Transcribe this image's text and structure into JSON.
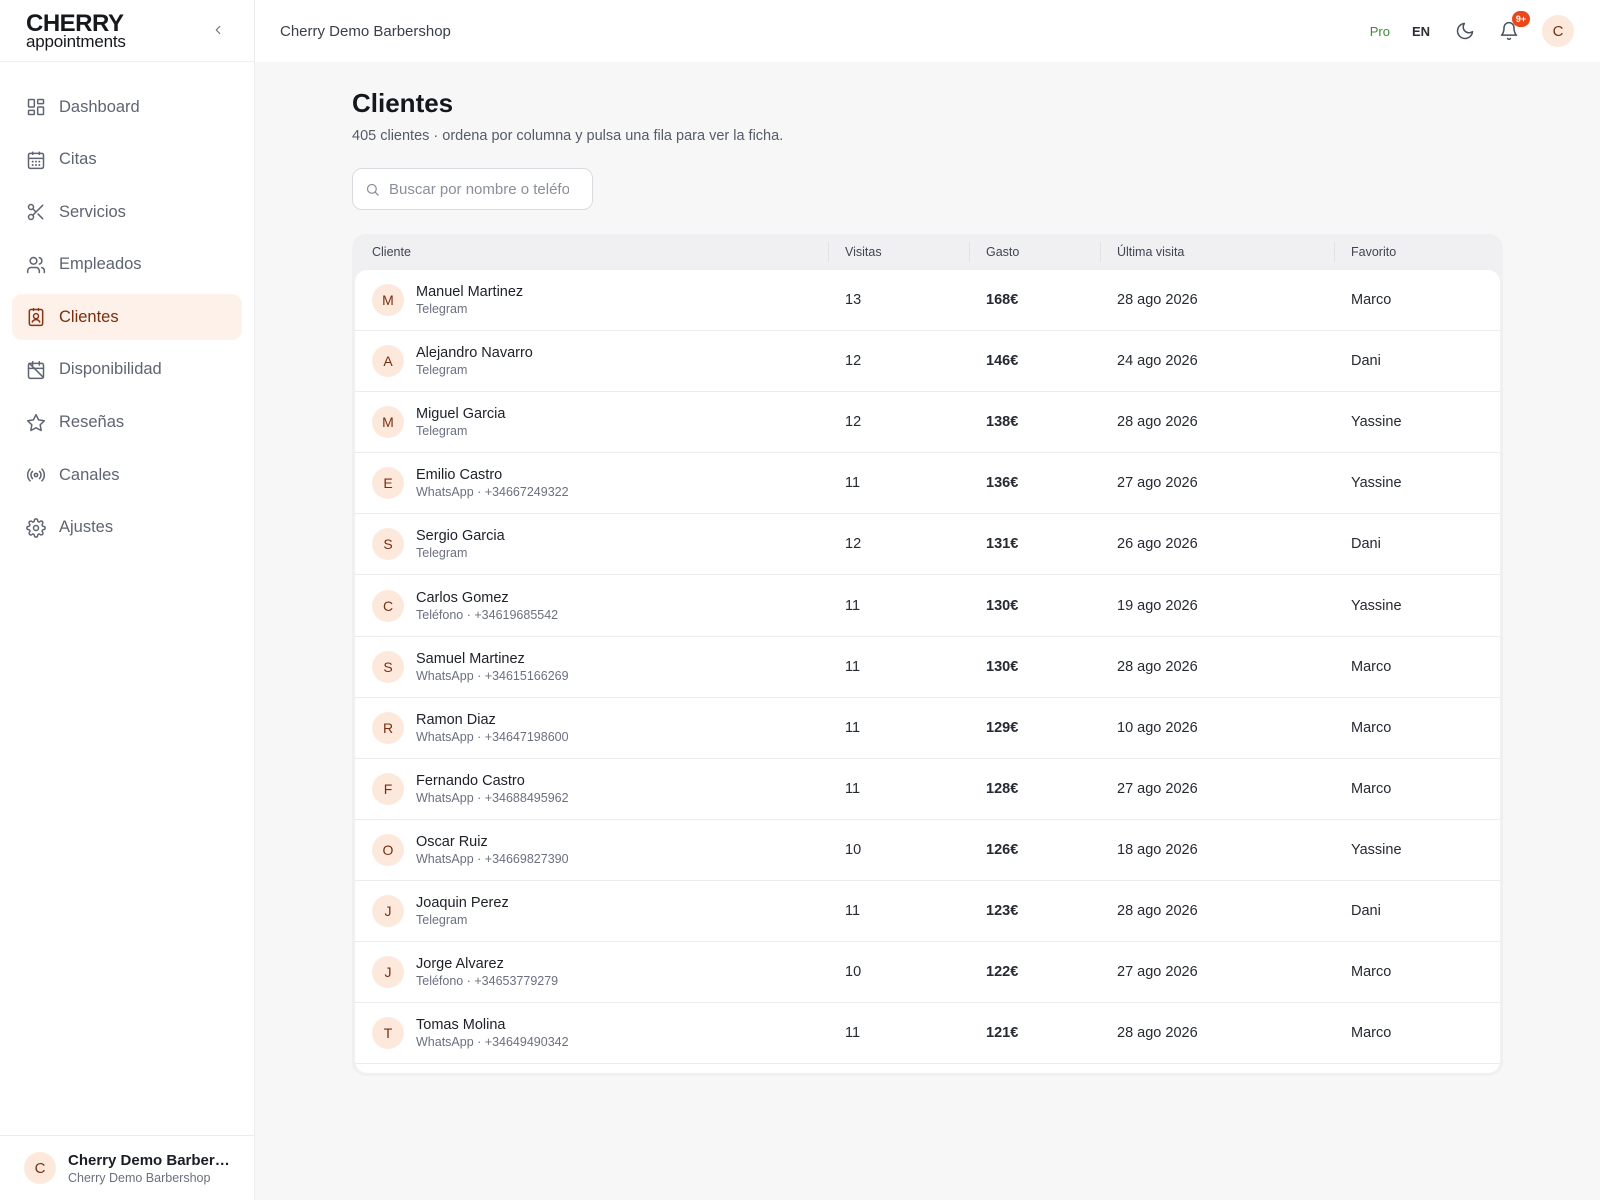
{
  "brand": {
    "main": "CHERRY",
    "sub": "appointments"
  },
  "sidebar": {
    "items": [
      {
        "label": "Dashboard",
        "icon": "dashboard-icon"
      },
      {
        "label": "Citas",
        "icon": "calendar-icon"
      },
      {
        "label": "Servicios",
        "icon": "scissors-icon"
      },
      {
        "label": "Empleados",
        "icon": "users-icon"
      },
      {
        "label": "Clientes",
        "icon": "contact-icon",
        "active": true
      },
      {
        "label": "Disponibilidad",
        "icon": "calendar-off-icon"
      },
      {
        "label": "Reseñas",
        "icon": "star-icon"
      },
      {
        "label": "Canales",
        "icon": "broadcast-icon"
      },
      {
        "label": "Ajustes",
        "icon": "gear-icon"
      }
    ],
    "footer": {
      "initial": "C",
      "name": "Cherry Demo Barbershop",
      "sub": "Cherry Demo Barbershop"
    }
  },
  "topbar": {
    "shop_name": "Cherry Demo Barbershop",
    "plan": "Pro",
    "language": "EN",
    "notifications_badge": "9+",
    "user_initial": "C"
  },
  "page": {
    "title": "Clientes",
    "subtitle": "405 clientes · ordena por columna y pulsa una fila para ver la ficha.",
    "search_placeholder": "Buscar por nombre o teléfono"
  },
  "table": {
    "columns": [
      "Cliente",
      "Visitas",
      "Gasto",
      "Última visita",
      "Favorito"
    ],
    "rows": [
      {
        "initial": "M",
        "name": "Manuel Martinez",
        "channel": "Telegram",
        "visits": "13",
        "spent": "168€",
        "last_visit": "28 ago 2026",
        "favorite": "Marco"
      },
      {
        "initial": "A",
        "name": "Alejandro Navarro",
        "channel": "Telegram",
        "visits": "12",
        "spent": "146€",
        "last_visit": "24 ago 2026",
        "favorite": "Dani"
      },
      {
        "initial": "M",
        "name": "Miguel Garcia",
        "channel": "Telegram",
        "visits": "12",
        "spent": "138€",
        "last_visit": "28 ago 2026",
        "favorite": "Yassine"
      },
      {
        "initial": "E",
        "name": "Emilio Castro",
        "channel": "WhatsApp · +34667249322",
        "visits": "11",
        "spent": "136€",
        "last_visit": "27 ago 2026",
        "favorite": "Yassine"
      },
      {
        "initial": "S",
        "name": "Sergio Garcia",
        "channel": "Telegram",
        "visits": "12",
        "spent": "131€",
        "last_visit": "26 ago 2026",
        "favorite": "Dani"
      },
      {
        "initial": "C",
        "name": "Carlos Gomez",
        "channel": "Teléfono · +34619685542",
        "visits": "11",
        "spent": "130€",
        "last_visit": "19 ago 2026",
        "favorite": "Yassine"
      },
      {
        "initial": "S",
        "name": "Samuel Martinez",
        "channel": "WhatsApp · +34615166269",
        "visits": "11",
        "spent": "130€",
        "last_visit": "28 ago 2026",
        "favorite": "Marco"
      },
      {
        "initial": "R",
        "name": "Ramon Diaz",
        "channel": "WhatsApp · +34647198600",
        "visits": "11",
        "spent": "129€",
        "last_visit": "10 ago 2026",
        "favorite": "Marco"
      },
      {
        "initial": "F",
        "name": "Fernando Castro",
        "channel": "WhatsApp · +34688495962",
        "visits": "11",
        "spent": "128€",
        "last_visit": "27 ago 2026",
        "favorite": "Marco"
      },
      {
        "initial": "O",
        "name": "Oscar Ruiz",
        "channel": "WhatsApp · +34669827390",
        "visits": "10",
        "spent": "126€",
        "last_visit": "18 ago 2026",
        "favorite": "Yassine"
      },
      {
        "initial": "J",
        "name": "Joaquin Perez",
        "channel": "Telegram",
        "visits": "11",
        "spent": "123€",
        "last_visit": "28 ago 2026",
        "favorite": "Dani"
      },
      {
        "initial": "J",
        "name": "Jorge Alvarez",
        "channel": "Teléfono · +34653779279",
        "visits": "10",
        "spent": "122€",
        "last_visit": "27 ago 2026",
        "favorite": "Marco"
      },
      {
        "initial": "T",
        "name": "Tomas Molina",
        "channel": "WhatsApp · +34649490342",
        "visits": "11",
        "spent": "121€",
        "last_visit": "28 ago 2026",
        "favorite": "Marco"
      }
    ]
  },
  "colors": {
    "accent": "#7a2e10",
    "active_bg": "#fdf1ea",
    "avatar_bg": "#fde9dc",
    "pro": "#3f8a3a",
    "badge": "#e8481a"
  }
}
